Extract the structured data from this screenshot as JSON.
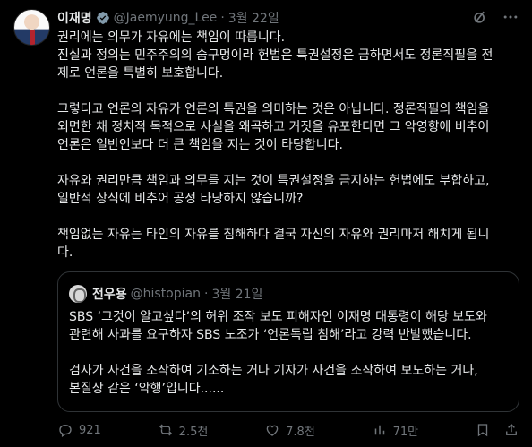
{
  "author": {
    "name": "이재명",
    "handle": "@Jaemyung_Lee",
    "date": "3월 22일"
  },
  "separator": "·",
  "body": {
    "p1": [
      "권리에는 의무가 자유에는 책임이 따릅니다.",
      "진실과 정의는 민주주의의 숨구멍이라 헌법은 특권설정은 금하면서도 정론직필을 전",
      "제로 언론을  특별히 보호합니다."
    ],
    "p2": [
      "그렇다고 언론의 자유가 언론의 특권을 의미하는 것은 아닙니다. 정론직필의 책임을",
      "외면한 채 정치적 목적으로 사실을 왜곡하고 거짓을 유포한다면 그 악영향에 비추어",
      "언론은 일반인보다 더 큰 책임을 지는 것이 타당합니다."
    ],
    "p3": [
      "자유와 권리만큼 책임과 의무를 지는 것이 특권설정을 금지하는 헌법에도 부합하고,",
      "일반적 상식에 비추어 공정 타당하지 않습니까?"
    ],
    "p4": [
      "책임없는 자유는 타인의 자유를 침해하다 결국 자신의 자유와 권리마저 해치게 됩니",
      "다."
    ]
  },
  "quote": {
    "name": "전우용",
    "handle": "@histopian",
    "date": "3월 21일",
    "p1": [
      "SBS ‘그것이 알고싶다’의 허위 조작 보도 피해자인 이재명 대통령이 해당 보도와",
      "관련해 사과를 요구하자 SBS 노조가 ‘언론독립 침해’라고 강력 반발했습니다."
    ],
    "p2": [
      "검사가 사건을 조작하여 기소하는 거나 기자가 사건을 조작하여 보도하는 거나,",
      "본질상 같은 ‘악행’입니다......"
    ]
  },
  "actions": {
    "replies": "921",
    "reposts": "2.5천",
    "likes": "7.8천",
    "views": "71만"
  },
  "icons": [
    "verified-badge-icon",
    "grok-icon",
    "more-icon",
    "reply-icon",
    "repost-icon",
    "like-icon",
    "views-icon",
    "bookmark-icon",
    "share-icon"
  ],
  "colors": {
    "background": "#000000",
    "text": "#e7e9ea",
    "muted": "#71767b",
    "verified": "#829aab",
    "border": "#2f3336"
  }
}
